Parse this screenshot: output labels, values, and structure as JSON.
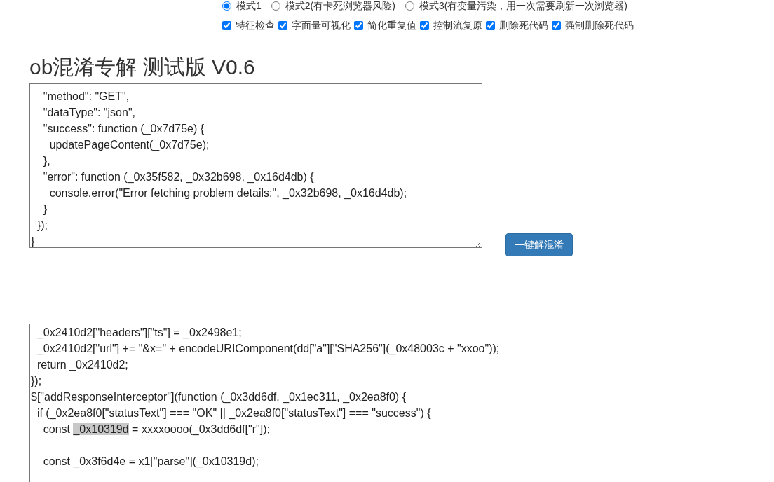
{
  "modes": [
    {
      "label": "模式1",
      "selected": true
    },
    {
      "label": "模式2(有卡死浏览器风险)",
      "selected": false
    },
    {
      "label": "模式3(有变量污染，用一次需要刷新一次浏览器)",
      "selected": false
    }
  ],
  "options": [
    {
      "label": "特征检查",
      "checked": true
    },
    {
      "label": "字面量可视化",
      "checked": true
    },
    {
      "label": "简化重复值",
      "checked": true
    },
    {
      "label": "控制流复原",
      "checked": true
    },
    {
      "label": "删除死代码",
      "checked": true
    },
    {
      "label": "强制删除死代码",
      "checked": true
    }
  ],
  "title": "ob混淆专解 测试版 V0.6",
  "input_code": {
    "lines": [
      "    \"method\": \"GET\",",
      "    \"dataType\": \"json\",",
      "    \"success\": function (_0x7d75e) {",
      "      updatePageContent(_0x7d75e);",
      "    },",
      "    \"error\": function (_0x35f582, _0x32b698, _0x16d4db) {",
      "      console.error(\"Error fetching problem details:\", _0x32b698, _0x16d4db);",
      "    }",
      "  });",
      "}"
    ]
  },
  "deobfuscate_button": {
    "label": "一键解混淆"
  },
  "output_code": {
    "lines": [
      {
        "kind": "text",
        "text": "  _0x2410d2[\"headers\"][\"ts\"] = _0x2498e1;"
      },
      {
        "kind": "text",
        "text": "  _0x2410d2[\"url\"] += \"&x=\" + encodeURIComponent(dd[\"a\"][\"SHA256\"](_0x48003c + \"xxoo\"));"
      },
      {
        "kind": "text",
        "text": "  return _0x2410d2;"
      },
      {
        "kind": "text",
        "text": "});"
      },
      {
        "kind": "text",
        "text": "$[\"addResponseInterceptor\"](function (_0x3dd6df, _0x1ec311, _0x2ea8f0) {"
      },
      {
        "kind": "text",
        "text": "  if (_0x2ea8f0[\"statusText\"] === \"OK\" || _0x2ea8f0[\"statusText\"] === \"success\") {"
      },
      {
        "kind": "selection",
        "before": "    const ",
        "highlighted_text": "_0x10319d",
        "after": " = xxxxoooo(_0x3dd6df[\"r\"]);"
      },
      {
        "kind": "blank"
      },
      {
        "kind": "text",
        "text": "    const _0x3f6d4e = x1[\"parse\"](_0x10319d);"
      }
    ]
  }
}
